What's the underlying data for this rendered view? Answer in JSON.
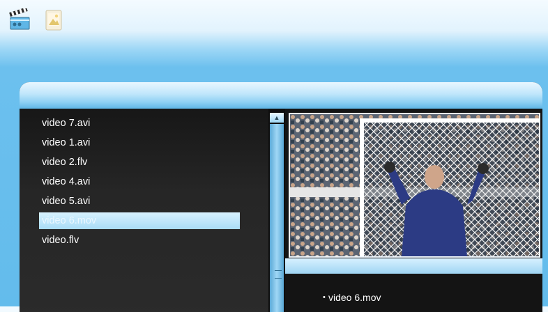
{
  "top_bar": {
    "icons": [
      "clapperboard-icon",
      "photo-icon"
    ]
  },
  "file_list": {
    "items": [
      {
        "label": "video  7.avi",
        "selected": false
      },
      {
        "label": "video 1.avi",
        "selected": false
      },
      {
        "label": "video 2.flv",
        "selected": false
      },
      {
        "label": "video 4.avi",
        "selected": false
      },
      {
        "label": "video 5.avi",
        "selected": false
      },
      {
        "label": "video 6.mov",
        "selected": true
      },
      {
        "label": "video.flv",
        "selected": false
      }
    ]
  },
  "preview": {
    "bullet": "•",
    "selected_title": "video 6.mov"
  },
  "colors": {
    "header_blue": "#63bcec",
    "panel_dark": "#1e1e1e",
    "highlight": "#a9dcf6"
  }
}
